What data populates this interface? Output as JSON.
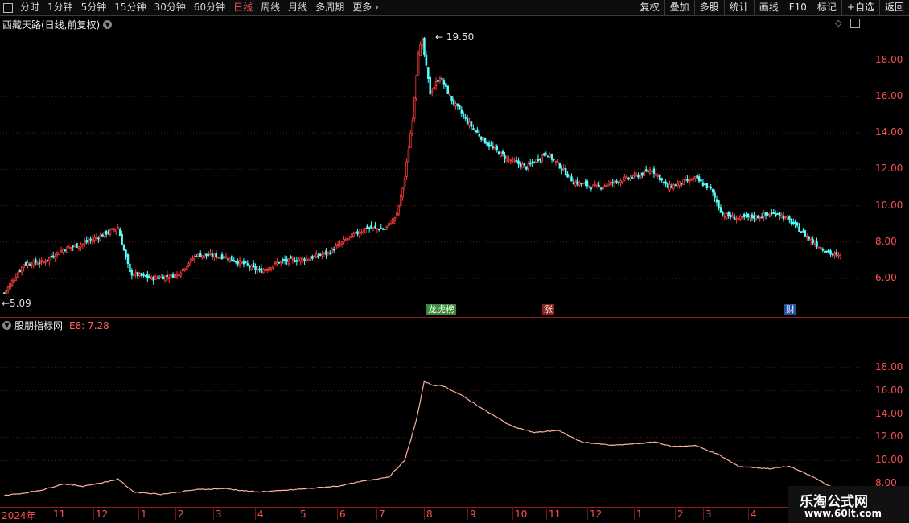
{
  "toolbar": {
    "periods": [
      "分时",
      "1分钟",
      "5分钟",
      "15分钟",
      "30分钟",
      "60分钟",
      "日线",
      "周线",
      "月线",
      "多周期",
      "更多"
    ],
    "active_period": "日线",
    "more_arrow": "›",
    "buttons": [
      "复权",
      "叠加",
      "多股",
      "统计",
      "画线",
      "F10",
      "标记",
      "+自选",
      "返回"
    ]
  },
  "main_panel": {
    "title": "西藏天路(日线,前复权)",
    "high_label": "19.50",
    "low_label": "5.09",
    "y_ticks": [
      "18.00",
      "16.00",
      "14.00",
      "12.00",
      "10.00",
      "8.00",
      "6.00"
    ],
    "markers": [
      {
        "text": "龙虎榜",
        "color": "#3a8a3a"
      },
      {
        "text": "涨",
        "color": "#8a2020"
      },
      {
        "text": "财",
        "color": "#2050a0"
      }
    ]
  },
  "indicator_panel": {
    "title": "股朋指标网",
    "value_label": "E8: 7.28",
    "y_ticks": [
      "18.00",
      "16.00",
      "14.00",
      "12.00",
      "10.00",
      "8.00"
    ]
  },
  "time_axis": {
    "labels": [
      "2024年",
      "11",
      "12",
      "1",
      "2",
      "3",
      "4",
      "5",
      "6",
      "7",
      "8",
      "9",
      "10",
      "11",
      "12",
      "1",
      "2",
      "3",
      "4"
    ]
  },
  "watermark": {
    "line1": "乐淘公式网",
    "line2": "www.60lt.com"
  },
  "chart_data": {
    "type": "candlestick",
    "ylim": [
      4.5,
      19.8
    ],
    "anchors_close": [
      [
        0,
        5.2
      ],
      [
        10,
        6.8
      ],
      [
        20,
        6.9
      ],
      [
        30,
        7.6
      ],
      [
        40,
        7.9
      ],
      [
        50,
        8.4
      ],
      [
        58,
        8.8
      ],
      [
        64,
        6.3
      ],
      [
        75,
        6.0
      ],
      [
        88,
        6.2
      ],
      [
        98,
        7.3
      ],
      [
        112,
        7.2
      ],
      [
        122,
        6.8
      ],
      [
        130,
        6.4
      ],
      [
        140,
        6.9
      ],
      [
        155,
        7.1
      ],
      [
        165,
        7.4
      ],
      [
        175,
        8.2
      ],
      [
        185,
        8.8
      ],
      [
        194,
        8.7
      ],
      [
        200,
        9.5
      ],
      [
        204,
        11.5
      ],
      [
        208,
        14.8
      ],
      [
        211,
        18.5
      ],
      [
        213,
        19.0
      ],
      [
        217,
        16.2
      ],
      [
        222,
        17.1
      ],
      [
        228,
        15.8
      ],
      [
        236,
        14.6
      ],
      [
        246,
        13.4
      ],
      [
        256,
        12.6
      ],
      [
        266,
        12.1
      ],
      [
        276,
        12.9
      ],
      [
        282,
        12.3
      ],
      [
        290,
        11.3
      ],
      [
        302,
        11.0
      ],
      [
        314,
        11.4
      ],
      [
        324,
        11.7
      ],
      [
        330,
        12.0
      ],
      [
        338,
        11.0
      ],
      [
        346,
        11.3
      ],
      [
        352,
        11.5
      ],
      [
        360,
        10.9
      ],
      [
        366,
        9.5
      ],
      [
        374,
        9.3
      ],
      [
        384,
        9.4
      ],
      [
        394,
        9.6
      ],
      [
        402,
        9.0
      ],
      [
        412,
        8.0
      ],
      [
        422,
        7.3
      ],
      [
        426,
        7.2
      ]
    ],
    "indicator_anchors": [
      [
        0,
        7.0
      ],
      [
        10,
        7.2
      ],
      [
        20,
        7.5
      ],
      [
        30,
        8.0
      ],
      [
        40,
        7.8
      ],
      [
        50,
        8.1
      ],
      [
        58,
        8.4
      ],
      [
        66,
        7.3
      ],
      [
        80,
        7.1
      ],
      [
        98,
        7.5
      ],
      [
        112,
        7.6
      ],
      [
        128,
        7.3
      ],
      [
        140,
        7.4
      ],
      [
        155,
        7.6
      ],
      [
        170,
        7.8
      ],
      [
        185,
        8.3
      ],
      [
        196,
        8.6
      ],
      [
        204,
        10.0
      ],
      [
        210,
        13.5
      ],
      [
        214,
        16.8
      ],
      [
        218,
        16.5
      ],
      [
        224,
        16.4
      ],
      [
        234,
        15.5
      ],
      [
        246,
        14.2
      ],
      [
        258,
        13.0
      ],
      [
        270,
        12.4
      ],
      [
        282,
        12.6
      ],
      [
        294,
        11.6
      ],
      [
        310,
        11.3
      ],
      [
        326,
        11.5
      ],
      [
        332,
        11.6
      ],
      [
        340,
        11.2
      ],
      [
        352,
        11.3
      ],
      [
        364,
        10.5
      ],
      [
        374,
        9.5
      ],
      [
        390,
        9.3
      ],
      [
        400,
        9.5
      ],
      [
        412,
        8.6
      ],
      [
        426,
        7.28
      ]
    ]
  }
}
